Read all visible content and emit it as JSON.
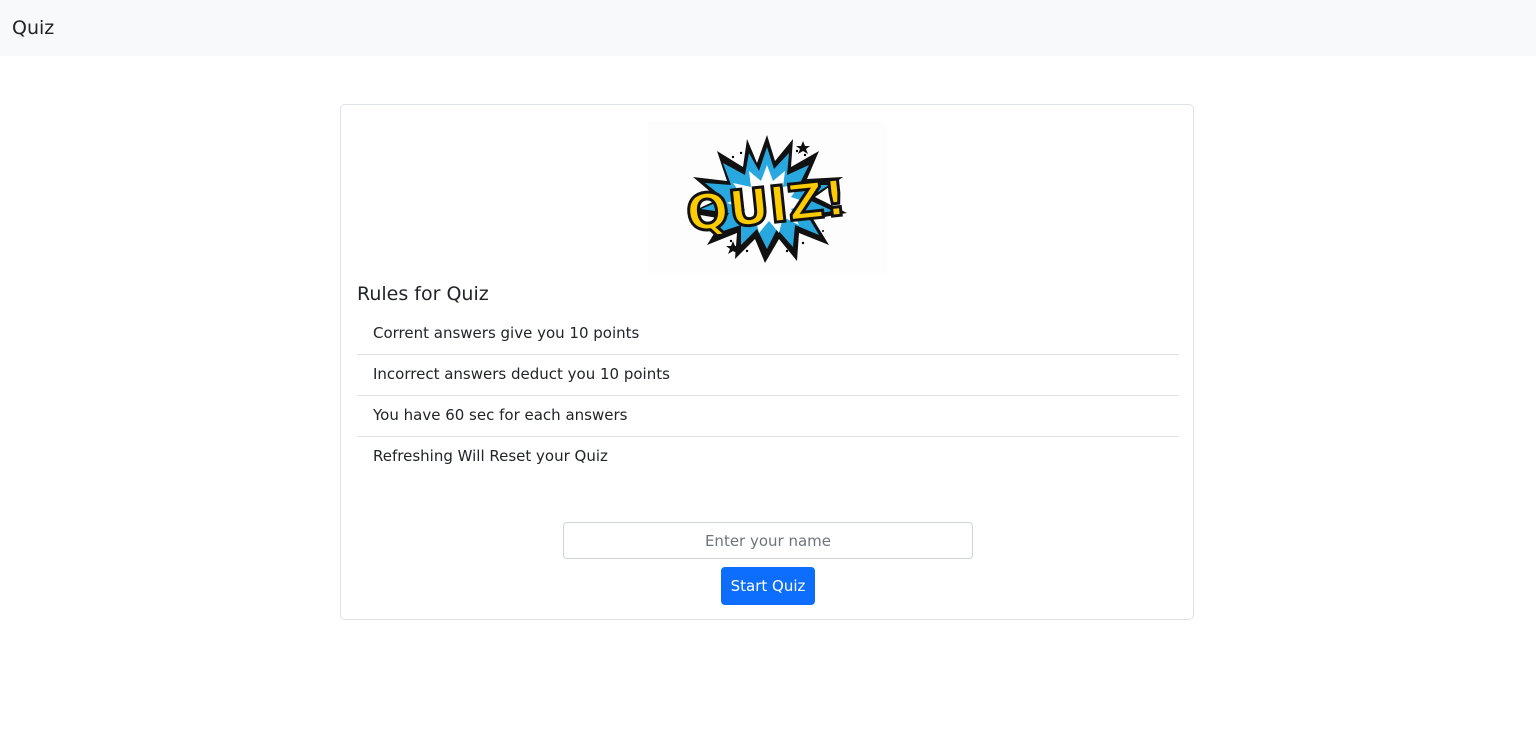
{
  "navbar": {
    "brand": "Quiz"
  },
  "card": {
    "logo_text": "QUIZ!",
    "rules_title": "Rules for Quiz",
    "rules": [
      "Corrent answers give you 10 points",
      "Incorrect answers deduct you 10 points",
      "You have 60 sec for each answers",
      "Refreshing Will Reset your Quiz"
    ],
    "name_input": {
      "value": "",
      "placeholder": "Enter your name"
    },
    "start_button": "Start Quiz"
  },
  "colors": {
    "navbar_bg": "#f8f9fa",
    "primary": "#0d6efd",
    "logo_yellow": "#ffcc00",
    "logo_blue": "#29a8e0"
  }
}
